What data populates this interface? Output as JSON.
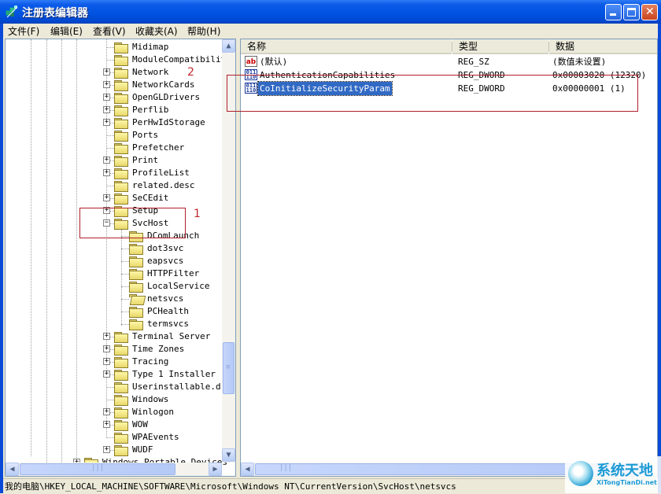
{
  "window": {
    "title": "注册表编辑器",
    "controls": {
      "minimize": "_",
      "maximize": "□",
      "close": "✕"
    }
  },
  "menu": [
    {
      "label": "文件(F)"
    },
    {
      "label": "编辑(E)"
    },
    {
      "label": "查看(V)"
    },
    {
      "label": "收藏夹(A)"
    },
    {
      "label": "帮助(H)"
    }
  ],
  "tree": {
    "items": [
      {
        "label": "Midimap",
        "expander": "none",
        "level": 1
      },
      {
        "label": "ModuleCompatibility",
        "expander": "none",
        "level": 1
      },
      {
        "label": "Network",
        "expander": "plus",
        "level": 1
      },
      {
        "label": "NetworkCards",
        "expander": "plus",
        "level": 1
      },
      {
        "label": "OpenGLDrivers",
        "expander": "plus",
        "level": 1
      },
      {
        "label": "Perflib",
        "expander": "plus",
        "level": 1
      },
      {
        "label": "PerHwIdStorage",
        "expander": "plus",
        "level": 1
      },
      {
        "label": "Ports",
        "expander": "none",
        "level": 1
      },
      {
        "label": "Prefetcher",
        "expander": "none",
        "level": 1
      },
      {
        "label": "Print",
        "expander": "plus",
        "level": 1
      },
      {
        "label": "ProfileList",
        "expander": "plus",
        "level": 1
      },
      {
        "label": "related.desc",
        "expander": "none",
        "level": 1
      },
      {
        "label": "SeCEdit",
        "expander": "plus",
        "level": 1
      },
      {
        "label": "Setup",
        "expander": "plus",
        "level": 1
      },
      {
        "label": "SvcHost",
        "expander": "minus",
        "level": 1
      },
      {
        "label": "DComLaunch",
        "expander": "none",
        "level": 2
      },
      {
        "label": "dot3svc",
        "expander": "none",
        "level": 2
      },
      {
        "label": "eapsvcs",
        "expander": "none",
        "level": 2
      },
      {
        "label": "HTTPFilter",
        "expander": "none",
        "level": 2
      },
      {
        "label": "LocalService",
        "expander": "none",
        "level": 2
      },
      {
        "label": "netsvcs",
        "expander": "none",
        "level": 2,
        "open": true
      },
      {
        "label": "PCHealth",
        "expander": "none",
        "level": 2
      },
      {
        "label": "termsvcs",
        "expander": "none",
        "level": 2
      },
      {
        "label": "Terminal Server",
        "expander": "plus",
        "level": 1
      },
      {
        "label": "Time Zones",
        "expander": "plus",
        "level": 1
      },
      {
        "label": "Tracing",
        "expander": "plus",
        "level": 1
      },
      {
        "label": "Type 1 Installer",
        "expander": "plus",
        "level": 1
      },
      {
        "label": "Userinstallable.dri",
        "expander": "none",
        "level": 1
      },
      {
        "label": "Windows",
        "expander": "none",
        "level": 1
      },
      {
        "label": "Winlogon",
        "expander": "plus",
        "level": 1
      },
      {
        "label": "WOW",
        "expander": "plus",
        "level": 1
      },
      {
        "label": "WPAEvents",
        "expander": "none",
        "level": 1
      },
      {
        "label": "WUDF",
        "expander": "plus",
        "level": 1
      },
      {
        "label": "Windows Portable Devices",
        "expander": "plus",
        "level": 0
      }
    ]
  },
  "list": {
    "columns": [
      {
        "label": "名称"
      },
      {
        "label": "类型"
      },
      {
        "label": "数据"
      }
    ],
    "rows": [
      {
        "icon": "string-value-icon",
        "icon_text": "ab",
        "name": "(默认)",
        "type": "REG_SZ",
        "data": "(数值未设置)",
        "selected": false
      },
      {
        "icon": "dword-value-icon",
        "icon_text": "011\n110",
        "name": "AuthenticationCapabilities",
        "type": "REG_DWORD",
        "data": "0x00003020 (12320)",
        "selected": false
      },
      {
        "icon": "dword-value-icon",
        "icon_text": "011\n110",
        "name": "CoInitializeSecurityParam",
        "type": "REG_DWORD",
        "data": "0x00000001 (1)",
        "selected": true
      }
    ]
  },
  "annotations": [
    {
      "label": "1"
    },
    {
      "label": "2"
    }
  ],
  "statusbar": {
    "path": "我的电脑\\HKEY_LOCAL_MACHINE\\SOFTWARE\\Microsoft\\Windows NT\\CurrentVersion\\SvcHost\\netsvcs"
  },
  "scroll": {
    "tree_vertical_position_fraction": 0.78,
    "tree_horizontal_position_fraction": 0.0
  },
  "watermark": {
    "title": "系统天地",
    "url": "XiTongTianDi.net"
  },
  "colors": {
    "titlebar": "#0052e0",
    "selection": "#316ac5",
    "annotation": "#c0282e",
    "watermark": "#1b9ad4"
  }
}
